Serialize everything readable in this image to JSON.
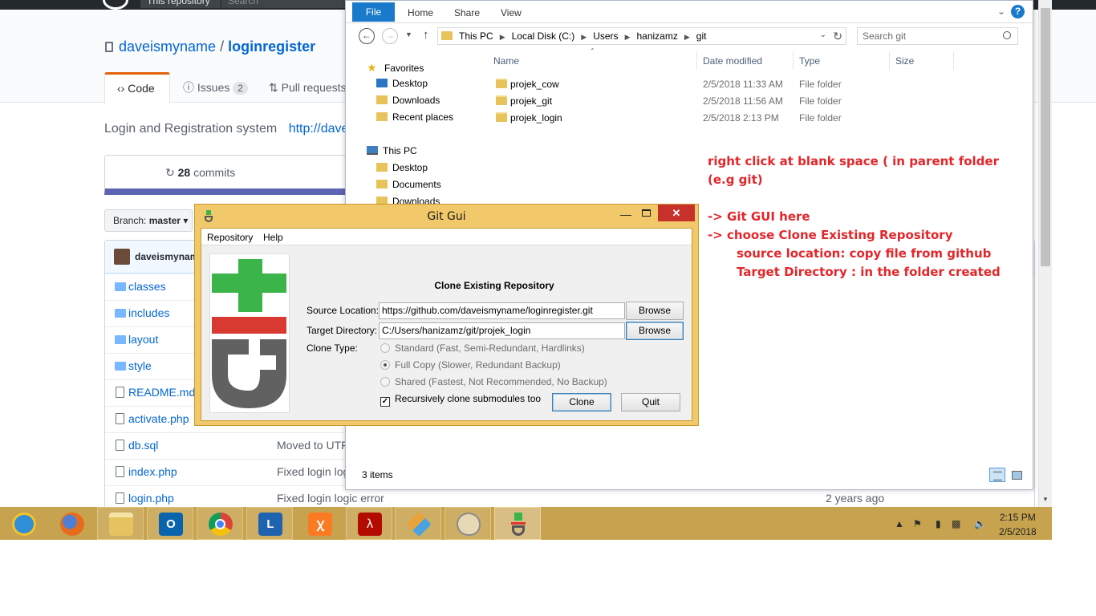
{
  "github": {
    "header": {
      "scope_label": "This repository",
      "search_placeholder": "Search"
    },
    "repo": {
      "owner": "daveismyname",
      "separator": "/",
      "name": "loginregister"
    },
    "tabs": [
      {
        "label": "Code"
      },
      {
        "label": "Issues",
        "count": "2"
      },
      {
        "label": "Pull requests"
      }
    ],
    "description": "Login and Registration system",
    "description_link": "http://dave",
    "commits": {
      "count": "28",
      "label": "commits"
    },
    "branch": {
      "prefix": "Branch:",
      "name": "master"
    },
    "commit_user": "daveismynam",
    "files": [
      {
        "name": "classes",
        "type": "dir",
        "message": "",
        "age": ""
      },
      {
        "name": "includes",
        "type": "dir",
        "message": "",
        "age": ""
      },
      {
        "name": "layout",
        "type": "dir",
        "message": "",
        "age": ""
      },
      {
        "name": "style",
        "type": "dir",
        "message": "",
        "age": ""
      },
      {
        "name": "README.md",
        "type": "file",
        "message": "",
        "age": ""
      },
      {
        "name": "activate.php",
        "type": "file",
        "message": "",
        "age": ""
      },
      {
        "name": "db.sql",
        "type": "file",
        "message": "Moved to UTF",
        "age": ""
      },
      {
        "name": "index.php",
        "type": "file",
        "message": "Fixed login log",
        "age": ""
      },
      {
        "name": "login.php",
        "type": "file",
        "message": "Fixed login logic error",
        "age": "2 years ago"
      }
    ]
  },
  "explorer": {
    "ribbon": {
      "file": "File",
      "home": "Home",
      "share": "Share",
      "view": "View",
      "help": "?"
    },
    "address": {
      "segments": [
        "This PC",
        "Local Disk (C:)",
        "Users",
        "hanizamz",
        "git"
      ]
    },
    "search_placeholder": "Search git",
    "nav": {
      "favorites": "Favorites",
      "fav_items": [
        "Desktop",
        "Downloads",
        "Recent places"
      ],
      "this_pc": "This PC",
      "pc_items": [
        "Desktop",
        "Documents",
        "Downloads"
      ]
    },
    "columns": {
      "name": "Name",
      "date": "Date modified",
      "type": "Type",
      "size": "Size"
    },
    "items": [
      {
        "name": "projek_cow",
        "date": "2/5/2018 11:33 AM",
        "type": "File folder"
      },
      {
        "name": "projek_git",
        "date": "2/5/2018 11:56 AM",
        "type": "File folder"
      },
      {
        "name": "projek_login",
        "date": "2/5/2018 2:13 PM",
        "type": "File folder"
      }
    ],
    "status": "3 items"
  },
  "annotation": {
    "line1": "right click at blank space ( in parent folder",
    "line2": "(e.g git)",
    "line3": "-> Git GUI here",
    "line4": "-> choose Clone Existing Repository",
    "line5": "source location: copy file from github",
    "line6": "Target Directory : in the folder created",
    "color": "#e3262a"
  },
  "gitgui": {
    "title": "Git Gui",
    "menu": {
      "repository": "Repository",
      "help": "Help"
    },
    "heading": "Clone Existing Repository",
    "source_label": "Source Location:",
    "source_value": "https://github.com/daveismyname/loginregister.git",
    "target_label": "Target Directory:",
    "target_value": "C:/Users/hanizamz/git/projek_login",
    "browse": "Browse",
    "clone_type_label": "Clone Type:",
    "clone_types": [
      {
        "label": "Standard (Fast, Semi-Redundant, Hardlinks)",
        "selected": false
      },
      {
        "label": "Full Copy (Slower, Redundant Backup)",
        "selected": true
      },
      {
        "label": "Shared (Fastest, Not Recommended, No Backup)",
        "selected": false
      }
    ],
    "recursive_label": "Recursively clone submodules too",
    "recursive_checked": true,
    "clone_button": "Clone",
    "quit_button": "Quit"
  },
  "taskbar": {
    "apps": [
      "internet-explorer",
      "firefox",
      "file-explorer",
      "outlook",
      "chrome",
      "lync",
      "xampp",
      "acrobat",
      "git-extensions",
      "paint",
      "git-gui"
    ],
    "outlook_glyph": "O",
    "lync_glyph": "L",
    "xampp_glyph": "ꭓ",
    "time": "2:15 PM",
    "date": "2/5/2018"
  }
}
